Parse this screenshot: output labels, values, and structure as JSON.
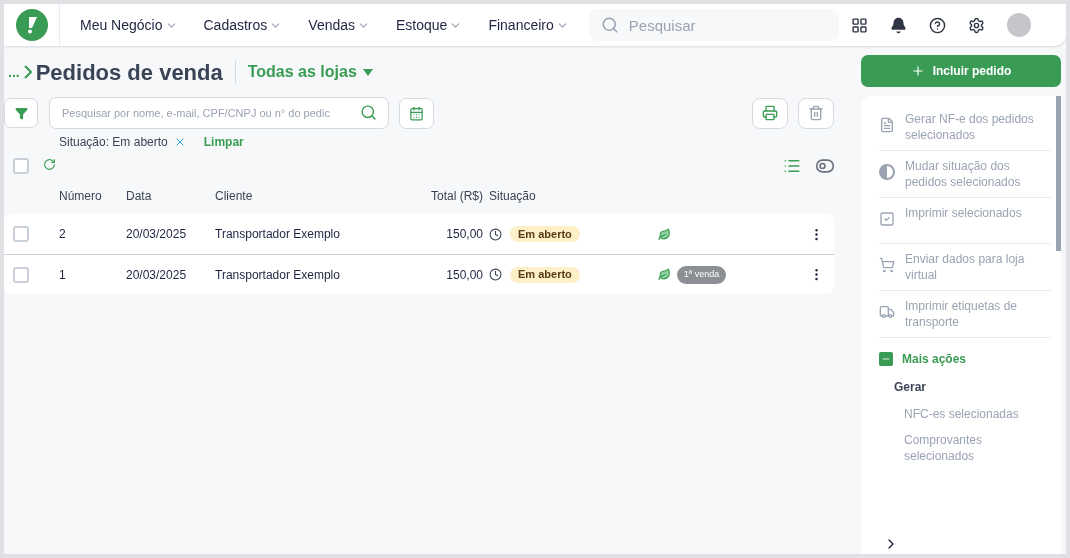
{
  "nav": {
    "menus": [
      {
        "label": "Meu Negócio"
      },
      {
        "label": "Cadastros"
      },
      {
        "label": "Vendas"
      },
      {
        "label": "Estoque"
      },
      {
        "label": "Financeiro"
      }
    ],
    "search": {
      "placeholder": "Pesquisar"
    }
  },
  "page": {
    "breadcrumb": "...",
    "title": "Pedidos de venda",
    "store_filter": "Todas as lojas"
  },
  "search": {
    "placeholder": "Pesquisar por nome, e-mail, CPF/CNPJ ou n° do pedic"
  },
  "active_filter": {
    "label": "Situação: Em aberto",
    "clear": "Limpar"
  },
  "select_all": {
    "checked": false
  },
  "table": {
    "columns": [
      "Número",
      "Data",
      "Cliente",
      "Total (R$)",
      "Situação"
    ],
    "rows": [
      {
        "checked": false,
        "number": "2",
        "date": "20/03/2025",
        "client": "Transportador Exemplo",
        "total": "150,00",
        "status": "Em aberto"
      },
      {
        "checked": false,
        "number": "1",
        "date": "20/03/2025",
        "client": "Transportador Exemplo",
        "total": "150,00",
        "status": "Em aberto",
        "tag": "1ª venda"
      }
    ]
  },
  "sidebar": {
    "primary_button": "Incluir pedido",
    "actions": [
      {
        "kind": "invoice",
        "label": "Gerar NF-e dos pedidos selecionados",
        "disabled": true
      },
      {
        "kind": "status",
        "label": "Mudar situação dos pedidos selecionados",
        "disabled": true
      },
      {
        "kind": "print",
        "label": "Imprimir selecionados",
        "disabled": true
      },
      {
        "kind": "cart",
        "label": "Enviar dados para loja virtual",
        "disabled": true
      },
      {
        "kind": "truck",
        "label": "Imprimir etiquetas de transporte",
        "disabled": true
      }
    ],
    "more": {
      "label": "Mais ações",
      "expanded": true,
      "group": "Gerar",
      "items": [
        {
          "label": "NFC-es selecionadas",
          "disabled": true
        },
        {
          "label": "Comprovantes selecionados",
          "disabled": true
        }
      ]
    }
  }
}
